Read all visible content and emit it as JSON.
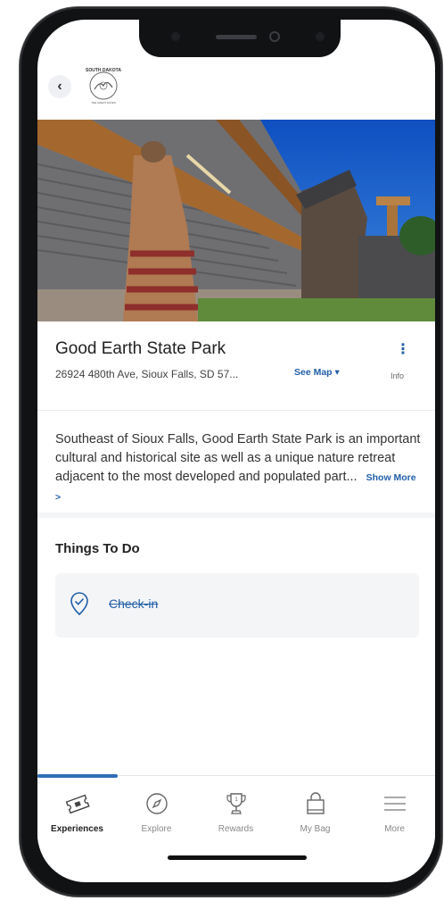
{
  "header": {
    "back_glyph": "‹",
    "logo_top_text": "SOUTH DAKOTA",
    "logo_bottom_text": "THE GREAT FACES"
  },
  "park": {
    "name": "Good Earth State Park",
    "address": "26924 480th Ave, Sioux Falls, SD 57...",
    "see_map": "See Map ▾",
    "info_label": "Info",
    "description": "Southeast of Sioux Falls, Good Earth State Park is an important cultural and historical site as well as a unique nature retreat adjacent to the most developed and populated part...",
    "show_more": "Show More >"
  },
  "things_to_do": {
    "title": "Things To Do",
    "items": [
      {
        "label": "Check-in",
        "icon": "map-pin-check-icon",
        "completed": true
      }
    ]
  },
  "tabbar": {
    "active": 0,
    "tabs": [
      {
        "label": "Experiences",
        "icon": "ticket-icon"
      },
      {
        "label": "Explore",
        "icon": "compass-icon"
      },
      {
        "label": "Rewards",
        "icon": "trophy-icon"
      },
      {
        "label": "My Bag",
        "icon": "bag-icon"
      },
      {
        "label": "More",
        "icon": "menu-icon"
      }
    ]
  },
  "colors": {
    "accent": "#1f5ea8",
    "tab_indicator": "#2f6db5",
    "card_bg": "#f4f5f7"
  }
}
